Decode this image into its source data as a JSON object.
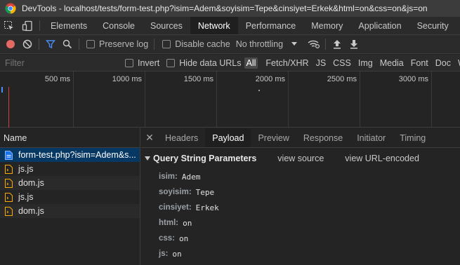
{
  "titlebar": {
    "app_icon": "chrome-icon",
    "title": "DevTools - localhost/tests/form-test.php?isim=Adem&soyisim=Tepe&cinsiyet=Erkek&html=on&css=on&js=on"
  },
  "tabs": [
    {
      "label": "Elements",
      "active": false
    },
    {
      "label": "Console",
      "active": false
    },
    {
      "label": "Sources",
      "active": false
    },
    {
      "label": "Network",
      "active": true
    },
    {
      "label": "Performance",
      "active": false
    },
    {
      "label": "Memory",
      "active": false
    },
    {
      "label": "Application",
      "active": false
    },
    {
      "label": "Security",
      "active": false
    }
  ],
  "toolbar": {
    "preserve_log_label": "Preserve log",
    "disable_cache_label": "Disable cache",
    "throttling_value": "No throttling",
    "icons": [
      "record-icon",
      "clear-icon",
      "filter-icon",
      "search-icon",
      "wifi-settings-icon",
      "upload-icon",
      "download-icon"
    ]
  },
  "filterbar": {
    "filter_placeholder": "Filter",
    "invert_label": "Invert",
    "hide_data_urls_label": "Hide data URLs",
    "types": [
      {
        "label": "All",
        "active": true
      },
      {
        "label": "Fetch/XHR",
        "active": false
      },
      {
        "label": "JS",
        "active": false
      },
      {
        "label": "CSS",
        "active": false
      },
      {
        "label": "Img",
        "active": false
      },
      {
        "label": "Media",
        "active": false
      },
      {
        "label": "Font",
        "active": false
      },
      {
        "label": "Doc",
        "active": false
      },
      {
        "label": "WS",
        "active": false
      }
    ]
  },
  "timeline": {
    "ticks": [
      "500 ms",
      "1000 ms",
      "1500 ms",
      "2000 ms",
      "2500 ms",
      "3000 ms"
    ],
    "colors": {
      "dom_content_loaded": "#4a8cf7",
      "load": "#d33d3d"
    }
  },
  "requests": {
    "header": "Name",
    "items": [
      {
        "name": "form-test.php?isim=Adem&s...",
        "icon": "document-icon",
        "selected": true
      },
      {
        "name": "js.js",
        "icon": "script-file-icon",
        "selected": false
      },
      {
        "name": "dom.js",
        "icon": "script-file-icon",
        "selected": false
      },
      {
        "name": "js.js",
        "icon": "script-file-icon",
        "selected": false
      },
      {
        "name": "dom.js",
        "icon": "script-file-icon",
        "selected": false
      }
    ]
  },
  "detail_tabs": [
    {
      "label": "Headers",
      "active": false
    },
    {
      "label": "Payload",
      "active": true
    },
    {
      "label": "Preview",
      "active": false
    },
    {
      "label": "Response",
      "active": false
    },
    {
      "label": "Initiator",
      "active": false
    },
    {
      "label": "Timing",
      "active": false
    }
  ],
  "payload": {
    "section_title": "Query String Parameters",
    "view_source": "view source",
    "view_url_encoded": "view URL-encoded",
    "params": [
      {
        "key": "isim:",
        "value": "Adem"
      },
      {
        "key": "soyisim:",
        "value": "Tepe"
      },
      {
        "key": "cinsiyet:",
        "value": "Erkek"
      },
      {
        "key": "html:",
        "value": "on"
      },
      {
        "key": "css:",
        "value": "on"
      },
      {
        "key": "js:",
        "value": "on"
      }
    ]
  },
  "colors": {
    "selected_row": "#073763",
    "accent_blue": "#4a8cf7",
    "record_red": "#e46962"
  }
}
